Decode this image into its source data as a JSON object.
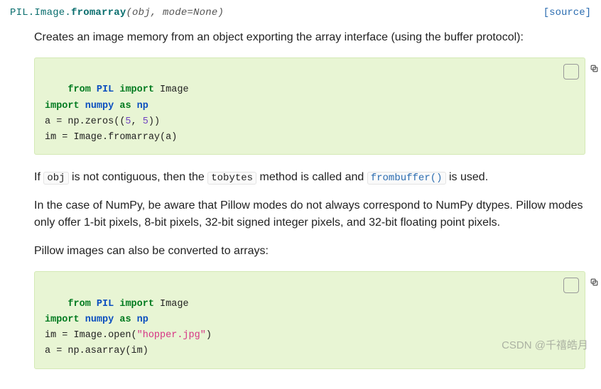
{
  "signature": {
    "module": "PIL.Image.",
    "func": "fromarray",
    "args": "(obj, mode=None)",
    "source_label": "[source]"
  },
  "para1": "Creates an image memory from an object exporting the array interface (using the buffer protocol):",
  "code1": {
    "l1_kw1": "from",
    "l1_nm": "PIL",
    "l1_kw2": "import",
    "l1_rest": " Image",
    "l2_kw1": "import",
    "l2_nm": "numpy",
    "l2_kw2": "as",
    "l2_alias": "np",
    "l3_pre": "a = np.zeros((",
    "l3_n1": "5",
    "l3_mid": ", ",
    "l3_n2": "5",
    "l3_post": "))",
    "l4": "im = Image.fromarray(a)"
  },
  "para2": {
    "t1": "If ",
    "obj": "obj",
    "t2": " is not contiguous, then the ",
    "tobytes": "tobytes",
    "t3": " method is called and ",
    "frombuffer": "frombuffer()",
    "t4": " is used."
  },
  "para3": "In the case of NumPy, be aware that Pillow modes do not always correspond to NumPy dtypes. Pillow modes only offer 1-bit pixels, 8-bit pixels, 32-bit signed integer pixels, and 32-bit floating point pixels.",
  "para4": "Pillow images can also be converted to arrays:",
  "code2": {
    "l1_kw1": "from",
    "l1_nm": "PIL",
    "l1_kw2": "import",
    "l1_rest": " Image",
    "l2_kw1": "import",
    "l2_nm": "numpy",
    "l2_kw2": "as",
    "l2_alias": "np",
    "l3_pre": "im = Image.open(",
    "l3_str": "\"hopper.jpg\"",
    "l3_post": ")",
    "l4": "a = np.asarray(im)"
  },
  "watermark": "CSDN @千禧皓月"
}
